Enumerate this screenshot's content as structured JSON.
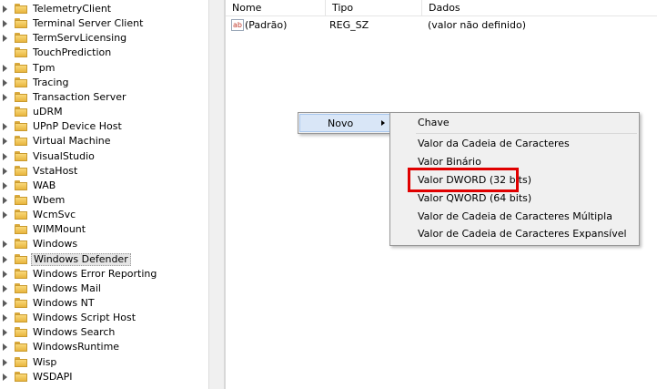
{
  "tree": {
    "items": [
      {
        "label": "TelemetryClient",
        "expandable": true
      },
      {
        "label": "Terminal Server Client",
        "expandable": true
      },
      {
        "label": "TermServLicensing",
        "expandable": true
      },
      {
        "label": "TouchPrediction",
        "expandable": false
      },
      {
        "label": "Tpm",
        "expandable": true
      },
      {
        "label": "Tracing",
        "expandable": true
      },
      {
        "label": "Transaction Server",
        "expandable": true
      },
      {
        "label": "uDRM",
        "expandable": false
      },
      {
        "label": "UPnP Device Host",
        "expandable": true
      },
      {
        "label": "Virtual Machine",
        "expandable": true
      },
      {
        "label": "VisualStudio",
        "expandable": true
      },
      {
        "label": "VstaHost",
        "expandable": true
      },
      {
        "label": "WAB",
        "expandable": true
      },
      {
        "label": "Wbem",
        "expandable": true
      },
      {
        "label": "WcmSvc",
        "expandable": true
      },
      {
        "label": "WIMMount",
        "expandable": false
      },
      {
        "label": "Windows",
        "expandable": true
      },
      {
        "label": "Windows Defender",
        "expandable": true,
        "selected": true
      },
      {
        "label": "Windows Error Reporting",
        "expandable": true
      },
      {
        "label": "Windows Mail",
        "expandable": true
      },
      {
        "label": "Windows NT",
        "expandable": true
      },
      {
        "label": "Windows Script Host",
        "expandable": true
      },
      {
        "label": "Windows Search",
        "expandable": true
      },
      {
        "label": "WindowsRuntime",
        "expandable": true
      },
      {
        "label": "Wisp",
        "expandable": true
      },
      {
        "label": "WSDAPI",
        "expandable": true
      }
    ]
  },
  "list": {
    "columns": {
      "name": "Nome",
      "type": "Tipo",
      "data": "Dados"
    },
    "rows": [
      {
        "icon": "ab",
        "name": "(Padrão)",
        "type": "REG_SZ",
        "data": "(valor não definido)"
      }
    ]
  },
  "context_menu": {
    "novo_label": "Novo",
    "submenu": {
      "key": "Chave",
      "items": [
        "Valor da Cadeia de Caracteres",
        "Valor Binário",
        "Valor DWORD (32 bits)",
        "Valor QWORD (64 bits)",
        "Valor de Cadeia de Caracteres Múltipla",
        "Valor de Cadeia de Caracteres Expansível"
      ]
    }
  },
  "icons": {
    "folder": "folder-icon",
    "expander": "expand-arrow-icon",
    "string_value": "string-value-icon",
    "submenu": "submenu-arrow-icon"
  },
  "colors": {
    "highlight_box": "#e00000",
    "menu_hover": "#d9e6f7",
    "folder": "#f9d97a"
  }
}
